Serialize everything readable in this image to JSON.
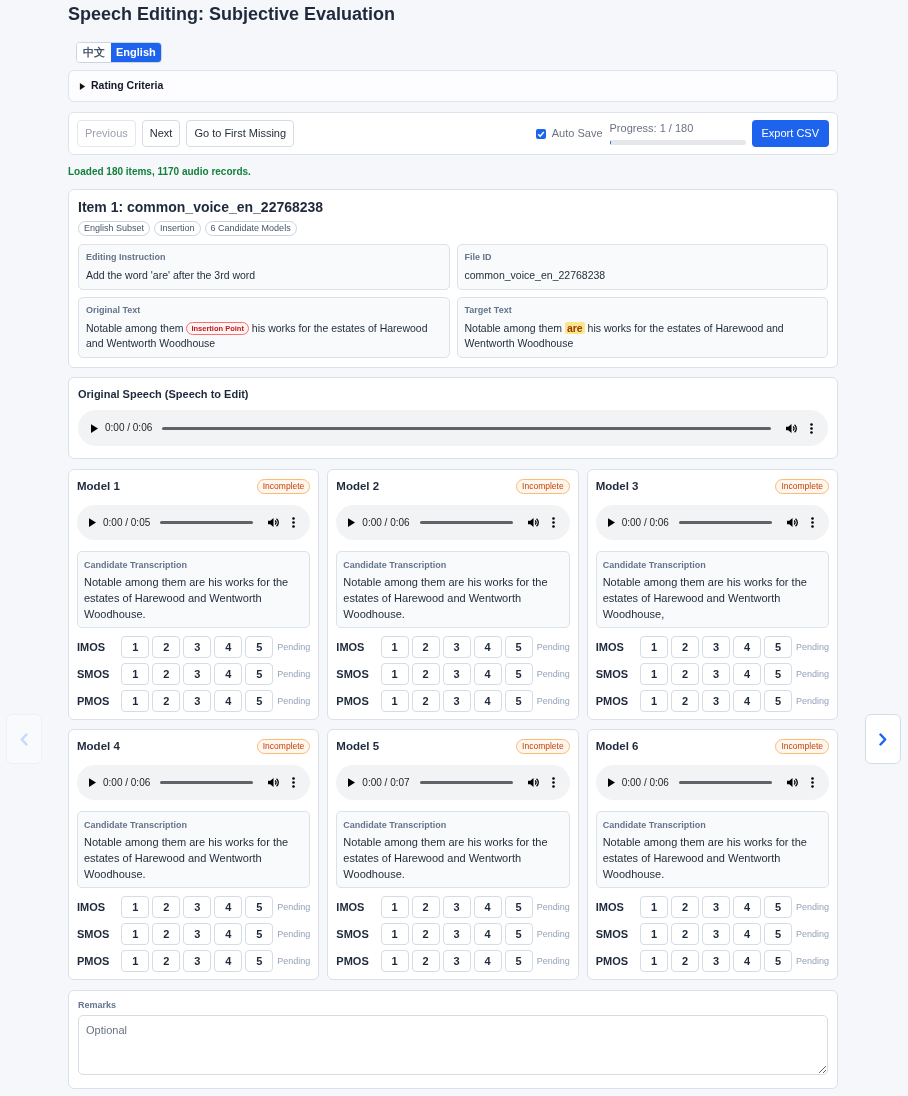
{
  "page": {
    "title": "Speech Editing: Subjective Evaluation"
  },
  "language_tabs": [
    {
      "label": "中文",
      "selected": false
    },
    {
      "label": "English",
      "selected": true
    }
  ],
  "rating_criteria": {
    "label": "Rating Criteria",
    "expanded": false
  },
  "toolbar": {
    "nav_buttons": [
      {
        "label": "Previous",
        "disabled": true
      },
      {
        "label": "Next",
        "disabled": false
      },
      {
        "label": "Go to First Missing",
        "disabled": false
      }
    ],
    "auto_save": {
      "label": "Auto Save",
      "checked": true
    },
    "progress": {
      "label": "Progress: 1 / 180",
      "level": 0.006
    },
    "export_button": {
      "label": "Export CSV"
    }
  },
  "status_message": "Loaded 180 items, 1170 audio records.",
  "item": {
    "title": "Item 1: common_voice_en_22768238",
    "tags": [
      "English Subset",
      "Insertion",
      "6 Candidate Models"
    ],
    "fields": [
      {
        "label": "Editing Instruction",
        "segments": [
          {
            "kind": "text",
            "text": "Add the word 'are' after the 3rd word"
          }
        ]
      },
      {
        "label": "File ID",
        "segments": [
          {
            "kind": "text",
            "text": "common_voice_en_22768238"
          }
        ]
      },
      {
        "label": "Original Text",
        "segments": [
          {
            "kind": "text",
            "text": "Notable among them "
          },
          {
            "kind": "insertion_marker",
            "text": "Insertion Point"
          },
          {
            "kind": "text",
            "text": " his works for the estates of Harewood and Wentworth Woodhouse"
          }
        ]
      },
      {
        "label": "Target Text",
        "segments": [
          {
            "kind": "text",
            "text": "Notable among them "
          },
          {
            "kind": "highlight",
            "text": "are"
          },
          {
            "kind": "text",
            "text": " his works for the estates of Harewood and Wentworth Woodhouse"
          }
        ]
      }
    ]
  },
  "original_speech": {
    "title": "Original Speech (Speech to Edit)",
    "audio_time": "0:00 / 0:06"
  },
  "models": [
    {
      "name": "Model 1",
      "status": {
        "label": "Incomplete",
        "complete": false
      },
      "audio_time": "0:00 / 0:05",
      "transcription_label": "Candidate Transcription",
      "transcription": "Notable among them are his works for the estates of Harewood and Wentworth Woodhouse.",
      "ratings": [
        {
          "metric": "IMOS",
          "status": "Pending",
          "scores": [
            {
              "label": "1",
              "selected": false
            },
            {
              "label": "2",
              "selected": false
            },
            {
              "label": "3",
              "selected": false
            },
            {
              "label": "4",
              "selected": false
            },
            {
              "label": "5",
              "selected": false
            }
          ]
        },
        {
          "metric": "SMOS",
          "status": "Pending",
          "scores": [
            {
              "label": "1",
              "selected": false
            },
            {
              "label": "2",
              "selected": false
            },
            {
              "label": "3",
              "selected": false
            },
            {
              "label": "4",
              "selected": false
            },
            {
              "label": "5",
              "selected": false
            }
          ]
        },
        {
          "metric": "PMOS",
          "status": "Pending",
          "scores": [
            {
              "label": "1",
              "selected": false
            },
            {
              "label": "2",
              "selected": false
            },
            {
              "label": "3",
              "selected": false
            },
            {
              "label": "4",
              "selected": false
            },
            {
              "label": "5",
              "selected": false
            }
          ]
        }
      ]
    },
    {
      "name": "Model 2",
      "status": {
        "label": "Incomplete",
        "complete": false
      },
      "audio_time": "0:00 / 0:06",
      "transcription_label": "Candidate Transcription",
      "transcription": "Notable among them are his works for the estates of Harewood and Wentworth Woodhouse.",
      "ratings": [
        {
          "metric": "IMOS",
          "status": "Pending",
          "scores": [
            {
              "label": "1",
              "selected": false
            },
            {
              "label": "2",
              "selected": false
            },
            {
              "label": "3",
              "selected": false
            },
            {
              "label": "4",
              "selected": false
            },
            {
              "label": "5",
              "selected": false
            }
          ]
        },
        {
          "metric": "SMOS",
          "status": "Pending",
          "scores": [
            {
              "label": "1",
              "selected": false
            },
            {
              "label": "2",
              "selected": false
            },
            {
              "label": "3",
              "selected": false
            },
            {
              "label": "4",
              "selected": false
            },
            {
              "label": "5",
              "selected": false
            }
          ]
        },
        {
          "metric": "PMOS",
          "status": "Pending",
          "scores": [
            {
              "label": "1",
              "selected": false
            },
            {
              "label": "2",
              "selected": false
            },
            {
              "label": "3",
              "selected": false
            },
            {
              "label": "4",
              "selected": false
            },
            {
              "label": "5",
              "selected": false
            }
          ]
        }
      ]
    },
    {
      "name": "Model 3",
      "status": {
        "label": "Incomplete",
        "complete": false
      },
      "audio_time": "0:00 / 0:06",
      "transcription_label": "Candidate Transcription",
      "transcription": "Notable among them are his works for the estates of Harewood and Wentworth Woodhouse,",
      "ratings": [
        {
          "metric": "IMOS",
          "status": "Pending",
          "scores": [
            {
              "label": "1",
              "selected": false
            },
            {
              "label": "2",
              "selected": false
            },
            {
              "label": "3",
              "selected": false
            },
            {
              "label": "4",
              "selected": false
            },
            {
              "label": "5",
              "selected": false
            }
          ]
        },
        {
          "metric": "SMOS",
          "status": "Pending",
          "scores": [
            {
              "label": "1",
              "selected": false
            },
            {
              "label": "2",
              "selected": false
            },
            {
              "label": "3",
              "selected": false
            },
            {
              "label": "4",
              "selected": false
            },
            {
              "label": "5",
              "selected": false
            }
          ]
        },
        {
          "metric": "PMOS",
          "status": "Pending",
          "scores": [
            {
              "label": "1",
              "selected": false
            },
            {
              "label": "2",
              "selected": false
            },
            {
              "label": "3",
              "selected": false
            },
            {
              "label": "4",
              "selected": false
            },
            {
              "label": "5",
              "selected": false
            }
          ]
        }
      ]
    },
    {
      "name": "Model 4",
      "status": {
        "label": "Incomplete",
        "complete": false
      },
      "audio_time": "0:00 / 0:06",
      "transcription_label": "Candidate Transcription",
      "transcription": "Notable among them are his works for the estates of Harewood and Wentworth Woodhouse.",
      "ratings": [
        {
          "metric": "IMOS",
          "status": "Pending",
          "scores": [
            {
              "label": "1",
              "selected": false
            },
            {
              "label": "2",
              "selected": false
            },
            {
              "label": "3",
              "selected": false
            },
            {
              "label": "4",
              "selected": false
            },
            {
              "label": "5",
              "selected": false
            }
          ]
        },
        {
          "metric": "SMOS",
          "status": "Pending",
          "scores": [
            {
              "label": "1",
              "selected": false
            },
            {
              "label": "2",
              "selected": false
            },
            {
              "label": "3",
              "selected": false
            },
            {
              "label": "4",
              "selected": false
            },
            {
              "label": "5",
              "selected": false
            }
          ]
        },
        {
          "metric": "PMOS",
          "status": "Pending",
          "scores": [
            {
              "label": "1",
              "selected": false
            },
            {
              "label": "2",
              "selected": false
            },
            {
              "label": "3",
              "selected": false
            },
            {
              "label": "4",
              "selected": false
            },
            {
              "label": "5",
              "selected": false
            }
          ]
        }
      ]
    },
    {
      "name": "Model 5",
      "status": {
        "label": "Incomplete",
        "complete": false
      },
      "audio_time": "0:00 / 0:07",
      "transcription_label": "Candidate Transcription",
      "transcription": "Notable among them are his works for the estates of Harewood and Wentworth Woodhouse.",
      "ratings": [
        {
          "metric": "IMOS",
          "status": "Pending",
          "scores": [
            {
              "label": "1",
              "selected": false
            },
            {
              "label": "2",
              "selected": false
            },
            {
              "label": "3",
              "selected": false
            },
            {
              "label": "4",
              "selected": false
            },
            {
              "label": "5",
              "selected": false
            }
          ]
        },
        {
          "metric": "SMOS",
          "status": "Pending",
          "scores": [
            {
              "label": "1",
              "selected": false
            },
            {
              "label": "2",
              "selected": false
            },
            {
              "label": "3",
              "selected": false
            },
            {
              "label": "4",
              "selected": false
            },
            {
              "label": "5",
              "selected": false
            }
          ]
        },
        {
          "metric": "PMOS",
          "status": "Pending",
          "scores": [
            {
              "label": "1",
              "selected": false
            },
            {
              "label": "2",
              "selected": false
            },
            {
              "label": "3",
              "selected": false
            },
            {
              "label": "4",
              "selected": false
            },
            {
              "label": "5",
              "selected": false
            }
          ]
        }
      ]
    },
    {
      "name": "Model 6",
      "status": {
        "label": "Incomplete",
        "complete": false
      },
      "audio_time": "0:00 / 0:06",
      "transcription_label": "Candidate Transcription",
      "transcription": "Notable among them are his works for the estates of Harewood and Wentworth Woodhouse.",
      "ratings": [
        {
          "metric": "IMOS",
          "status": "Pending",
          "scores": [
            {
              "label": "1",
              "selected": false
            },
            {
              "label": "2",
              "selected": false
            },
            {
              "label": "3",
              "selected": false
            },
            {
              "label": "4",
              "selected": false
            },
            {
              "label": "5",
              "selected": false
            }
          ]
        },
        {
          "metric": "SMOS",
          "status": "Pending",
          "scores": [
            {
              "label": "1",
              "selected": false
            },
            {
              "label": "2",
              "selected": false
            },
            {
              "label": "3",
              "selected": false
            },
            {
              "label": "4",
              "selected": false
            },
            {
              "label": "5",
              "selected": false
            }
          ]
        },
        {
          "metric": "PMOS",
          "status": "Pending",
          "scores": [
            {
              "label": "1",
              "selected": false
            },
            {
              "label": "2",
              "selected": false
            },
            {
              "label": "3",
              "selected": false
            },
            {
              "label": "4",
              "selected": false
            },
            {
              "label": "5",
              "selected": false
            }
          ]
        }
      ]
    }
  ],
  "remarks": {
    "label": "Remarks",
    "placeholder": "Optional"
  },
  "side_nav": {
    "previous": {
      "disabled": true
    },
    "next": {
      "disabled": false
    }
  }
}
